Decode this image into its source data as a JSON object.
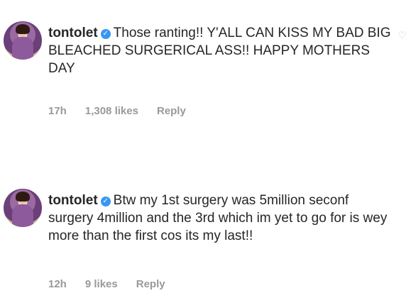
{
  "comments": [
    {
      "username": "tontolet",
      "text": "Those ranting!! Y'ALL CAN KISS MY BAD BIG BLEACHED SURGERICAL ASS!! HAPPY MOTHERS DAY",
      "time": "17h",
      "likes": "1,308 likes",
      "reply": "Reply"
    },
    {
      "username": "tontolet",
      "text": "Btw my 1st surgery was 5million seconf surgery 4million and the 3rd which im yet to go for is wey more than the first cos its my last!!",
      "time": "12h",
      "likes": "9 likes",
      "reply": "Reply"
    }
  ],
  "icons": {
    "verified": "verified-badge-icon",
    "like": "heart-icon"
  },
  "colors": {
    "verified": "#3897f0",
    "meta": "#999999",
    "text": "#262626"
  }
}
